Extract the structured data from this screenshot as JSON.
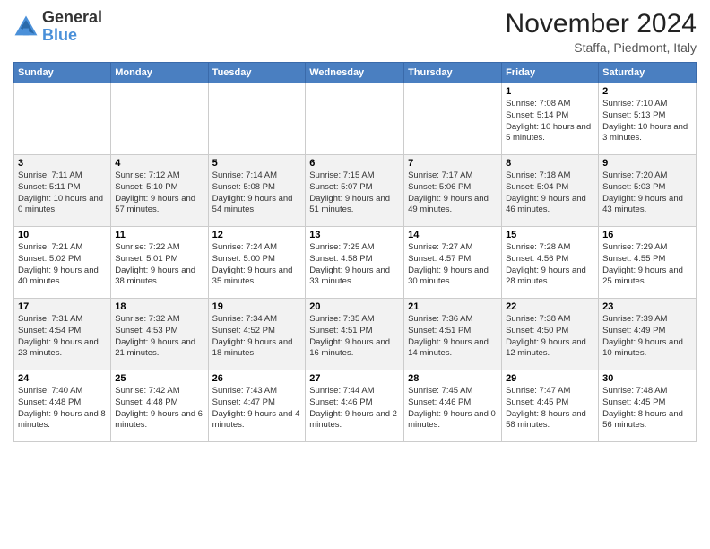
{
  "logo": {
    "general": "General",
    "blue": "Blue"
  },
  "header": {
    "month_title": "November 2024",
    "subtitle": "Staffa, Piedmont, Italy"
  },
  "weekdays": [
    "Sunday",
    "Monday",
    "Tuesday",
    "Wednesday",
    "Thursday",
    "Friday",
    "Saturday"
  ],
  "weeks": [
    [
      {
        "day": "",
        "info": ""
      },
      {
        "day": "",
        "info": ""
      },
      {
        "day": "",
        "info": ""
      },
      {
        "day": "",
        "info": ""
      },
      {
        "day": "",
        "info": ""
      },
      {
        "day": "1",
        "info": "Sunrise: 7:08 AM\nSunset: 5:14 PM\nDaylight: 10 hours\nand 5 minutes."
      },
      {
        "day": "2",
        "info": "Sunrise: 7:10 AM\nSunset: 5:13 PM\nDaylight: 10 hours\nand 3 minutes."
      }
    ],
    [
      {
        "day": "3",
        "info": "Sunrise: 7:11 AM\nSunset: 5:11 PM\nDaylight: 10 hours\nand 0 minutes."
      },
      {
        "day": "4",
        "info": "Sunrise: 7:12 AM\nSunset: 5:10 PM\nDaylight: 9 hours\nand 57 minutes."
      },
      {
        "day": "5",
        "info": "Sunrise: 7:14 AM\nSunset: 5:08 PM\nDaylight: 9 hours\nand 54 minutes."
      },
      {
        "day": "6",
        "info": "Sunrise: 7:15 AM\nSunset: 5:07 PM\nDaylight: 9 hours\nand 51 minutes."
      },
      {
        "day": "7",
        "info": "Sunrise: 7:17 AM\nSunset: 5:06 PM\nDaylight: 9 hours\nand 49 minutes."
      },
      {
        "day": "8",
        "info": "Sunrise: 7:18 AM\nSunset: 5:04 PM\nDaylight: 9 hours\nand 46 minutes."
      },
      {
        "day": "9",
        "info": "Sunrise: 7:20 AM\nSunset: 5:03 PM\nDaylight: 9 hours\nand 43 minutes."
      }
    ],
    [
      {
        "day": "10",
        "info": "Sunrise: 7:21 AM\nSunset: 5:02 PM\nDaylight: 9 hours\nand 40 minutes."
      },
      {
        "day": "11",
        "info": "Sunrise: 7:22 AM\nSunset: 5:01 PM\nDaylight: 9 hours\nand 38 minutes."
      },
      {
        "day": "12",
        "info": "Sunrise: 7:24 AM\nSunset: 5:00 PM\nDaylight: 9 hours\nand 35 minutes."
      },
      {
        "day": "13",
        "info": "Sunrise: 7:25 AM\nSunset: 4:58 PM\nDaylight: 9 hours\nand 33 minutes."
      },
      {
        "day": "14",
        "info": "Sunrise: 7:27 AM\nSunset: 4:57 PM\nDaylight: 9 hours\nand 30 minutes."
      },
      {
        "day": "15",
        "info": "Sunrise: 7:28 AM\nSunset: 4:56 PM\nDaylight: 9 hours\nand 28 minutes."
      },
      {
        "day": "16",
        "info": "Sunrise: 7:29 AM\nSunset: 4:55 PM\nDaylight: 9 hours\nand 25 minutes."
      }
    ],
    [
      {
        "day": "17",
        "info": "Sunrise: 7:31 AM\nSunset: 4:54 PM\nDaylight: 9 hours\nand 23 minutes."
      },
      {
        "day": "18",
        "info": "Sunrise: 7:32 AM\nSunset: 4:53 PM\nDaylight: 9 hours\nand 21 minutes."
      },
      {
        "day": "19",
        "info": "Sunrise: 7:34 AM\nSunset: 4:52 PM\nDaylight: 9 hours\nand 18 minutes."
      },
      {
        "day": "20",
        "info": "Sunrise: 7:35 AM\nSunset: 4:51 PM\nDaylight: 9 hours\nand 16 minutes."
      },
      {
        "day": "21",
        "info": "Sunrise: 7:36 AM\nSunset: 4:51 PM\nDaylight: 9 hours\nand 14 minutes."
      },
      {
        "day": "22",
        "info": "Sunrise: 7:38 AM\nSunset: 4:50 PM\nDaylight: 9 hours\nand 12 minutes."
      },
      {
        "day": "23",
        "info": "Sunrise: 7:39 AM\nSunset: 4:49 PM\nDaylight: 9 hours\nand 10 minutes."
      }
    ],
    [
      {
        "day": "24",
        "info": "Sunrise: 7:40 AM\nSunset: 4:48 PM\nDaylight: 9 hours\nand 8 minutes."
      },
      {
        "day": "25",
        "info": "Sunrise: 7:42 AM\nSunset: 4:48 PM\nDaylight: 9 hours\nand 6 minutes."
      },
      {
        "day": "26",
        "info": "Sunrise: 7:43 AM\nSunset: 4:47 PM\nDaylight: 9 hours\nand 4 minutes."
      },
      {
        "day": "27",
        "info": "Sunrise: 7:44 AM\nSunset: 4:46 PM\nDaylight: 9 hours\nand 2 minutes."
      },
      {
        "day": "28",
        "info": "Sunrise: 7:45 AM\nSunset: 4:46 PM\nDaylight: 9 hours\nand 0 minutes."
      },
      {
        "day": "29",
        "info": "Sunrise: 7:47 AM\nSunset: 4:45 PM\nDaylight: 8 hours\nand 58 minutes."
      },
      {
        "day": "30",
        "info": "Sunrise: 7:48 AM\nSunset: 4:45 PM\nDaylight: 8 hours\nand 56 minutes."
      }
    ]
  ]
}
